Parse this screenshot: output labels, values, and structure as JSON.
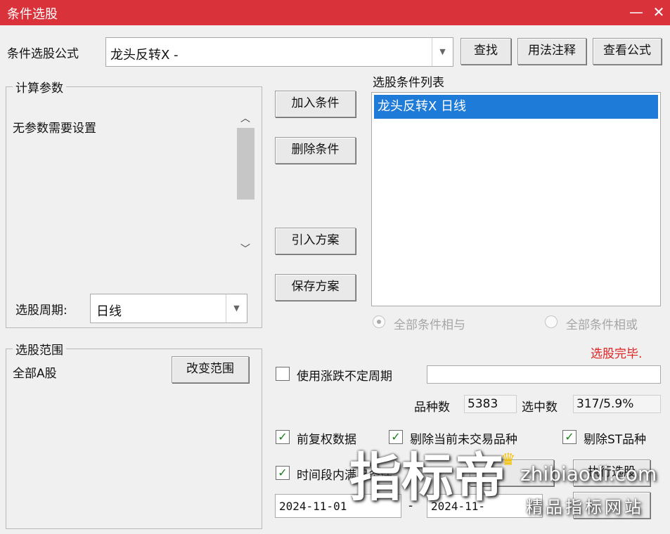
{
  "window": {
    "title": "条件选股",
    "minimize": "—",
    "close": "✕"
  },
  "formula": {
    "label": "条件选股公式",
    "value": "龙头反转X  -",
    "buttons": {
      "find": "查找",
      "usage": "用法注释",
      "view": "查看公式"
    }
  },
  "params": {
    "legend": "计算参数",
    "text": "无参数需要设置",
    "period_label": "选股周期:",
    "period_value": "日线"
  },
  "actions": {
    "add": "加入条件",
    "delete": "删除条件",
    "import": "引入方案",
    "save": "保存方案"
  },
  "conditions": {
    "title": "选股条件列表",
    "items": [
      "龙头反转X  日线"
    ],
    "radio_and": "全部条件相与",
    "radio_or": "全部条件相或"
  },
  "status": {
    "text": "选股完毕.",
    "color": "#e02020"
  },
  "range": {
    "legend": "选股范围",
    "value": "全部A股",
    "change_button": "改变范围"
  },
  "options": {
    "use_period_label": "使用涨跌不定周期",
    "count_label": "品种数",
    "count_value": "5383",
    "selected_label": "选中数",
    "selected_value": "317/5.9%",
    "forward_adjust": "前复权数据",
    "exclude_untraded": "剔除当前未交易品种",
    "exclude_st": "剔除ST品种",
    "time_range": "时间段内满足条件",
    "date_from": "2024-11-01",
    "date_to": "2024-11-",
    "execute_button": "执行选股"
  },
  "watermark": {
    "main": "指标帝",
    "url": "zhibiaodi.com",
    "sub": "精品指标网站"
  }
}
